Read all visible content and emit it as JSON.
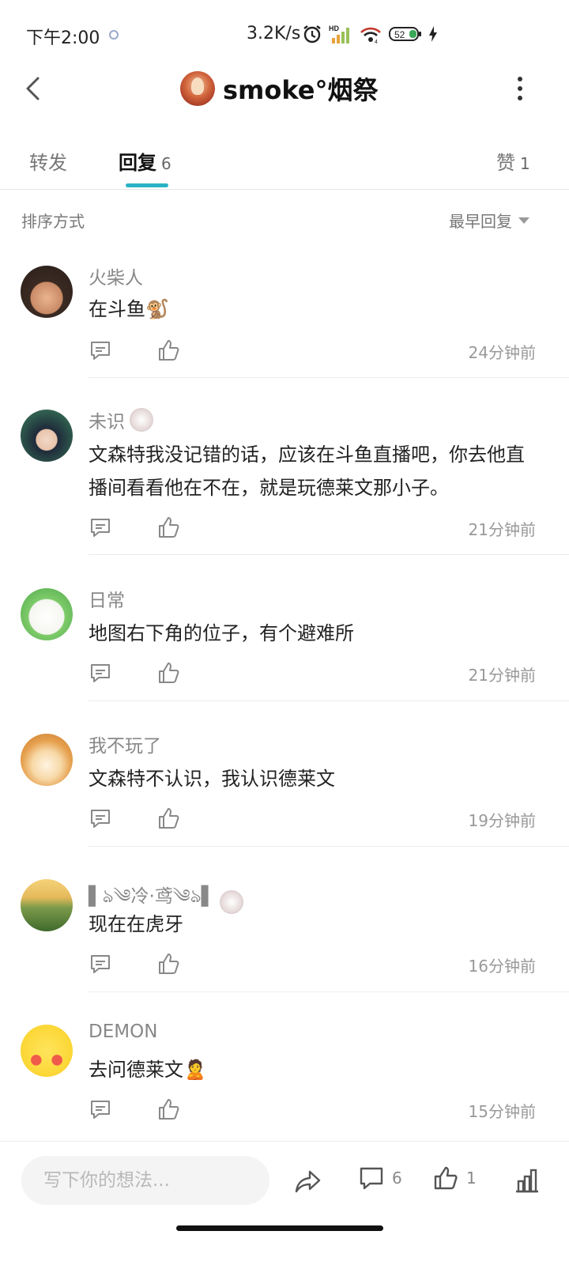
{
  "status_bar": {
    "time": "下午2:00",
    "net_speed": "3.2K/s",
    "battery": "52",
    "icons": [
      "alarm-icon",
      "hd-signal-icon",
      "wifi-icon",
      "battery-icon",
      "charging-icon"
    ]
  },
  "header": {
    "title": "smoke°烟祭",
    "back_icon": "chevron-left-icon",
    "more_icon": "more-vertical-icon"
  },
  "tabs": {
    "forward": {
      "label": "转发"
    },
    "reply": {
      "label": "回复",
      "count": "6"
    },
    "like": {
      "label": "赞",
      "count": "1"
    },
    "accent_color": "#2ab3c6"
  },
  "sort": {
    "label": "排序方式",
    "value": "最早回复"
  },
  "comments": [
    {
      "name": "火柴人",
      "text": "在斗鱼🐒",
      "time": "24分钟前"
    },
    {
      "name": "未识",
      "text": "文森特我没记错的话，应该在斗鱼直播吧，你去他直播间看看他在不在，就是玩德莱文那小子。",
      "time": "21分钟前"
    },
    {
      "name": "日常",
      "text": "地图右下角的位子，有个避难所",
      "time": "21分钟前"
    },
    {
      "name": "我不玩了",
      "text": "文森特不认识，我认识德莱文",
      "time": "19分钟前"
    },
    {
      "name": "▌ঌ༄冷·鸢༄ঌ▌",
      "text": "现在在虎牙",
      "time": "16分钟前"
    },
    {
      "name": "DEMON",
      "text": "去问德莱文🙎",
      "time": "15分钟前"
    }
  ],
  "bottom_bar": {
    "input_placeholder": "写下你的想法...",
    "comment_count": "6",
    "like_count": "1"
  }
}
